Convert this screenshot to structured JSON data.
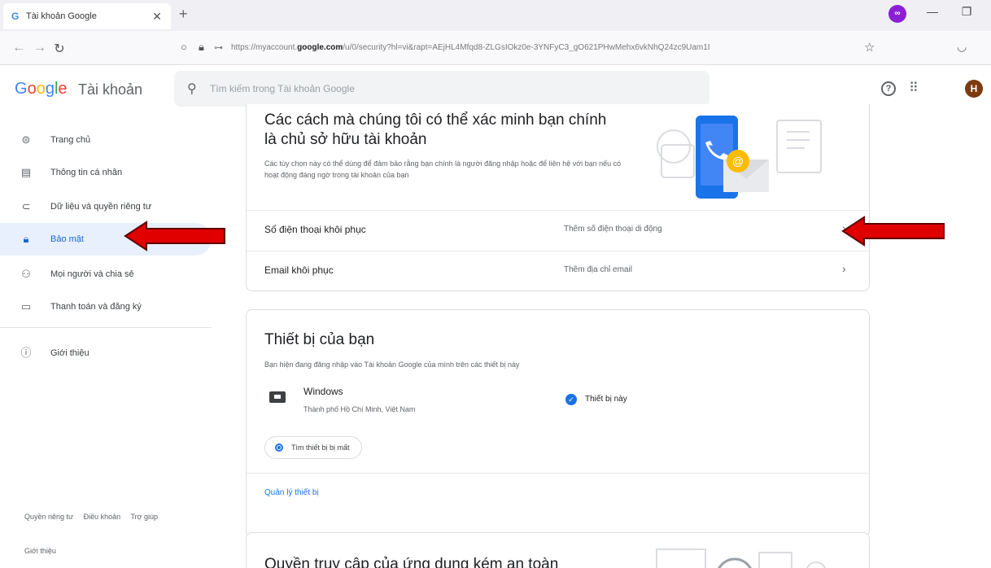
{
  "browser": {
    "tab_title": "Tài khoản Google",
    "tab_favicon": "G",
    "url_domain_prefix": "https://myaccount.",
    "url_domain": "google.com",
    "url_rest": "/u/0/security?hl=vi&rapt=AEjHL4Mfqd8-ZLGsIOkz0e-3YNFyC3_gO621PHwMehx6vkNhQ24zc9Uam1I",
    "ext_label": "∞"
  },
  "header": {
    "logo_letters": [
      "G",
      "o",
      "o",
      "g",
      "l",
      "e"
    ],
    "logo_suffix": "Tài khoản",
    "search_placeholder": "Tìm kiếm trong Tài khoản Google",
    "avatar_letter": "H",
    "help_glyph": "?"
  },
  "sidebar": {
    "items": [
      {
        "label": "Trang chủ",
        "icon": "home-icon"
      },
      {
        "label": "Thông tin cá nhân",
        "icon": "id-card-icon"
      },
      {
        "label": "Dữ liệu và quyền riêng tư",
        "icon": "toggle-icon"
      },
      {
        "label": "Bảo mật",
        "icon": "lock-icon",
        "active": true
      },
      {
        "label": "Mọi người và chia sẻ",
        "icon": "people-icon"
      },
      {
        "label": "Thanh toán và đăng ký",
        "icon": "card-icon"
      },
      {
        "label": "Giới thiệu",
        "icon": "info-icon"
      }
    ],
    "footer_links": [
      "Quyền riêng tư",
      "Điều khoản",
      "Trợ giúp"
    ],
    "footer_about": "Giới thiệu"
  },
  "verify_card": {
    "title": "Các cách mà chúng tôi có thể xác minh bạn chính là chủ sở hữu tài khoản",
    "description": "Các tùy chọn này có thể dùng để đảm bảo rằng bạn chính là người đăng nhập hoặc để liên hệ với bạn nếu có hoạt động đáng ngờ trong tài khoản của bạn",
    "rows": [
      {
        "label": "Số điện thoại khôi phục",
        "value": "Thêm số điện thoại di động"
      },
      {
        "label": "Email khôi phục",
        "value": "Thêm địa chỉ email"
      }
    ]
  },
  "devices_card": {
    "title": "Thiết bị của bạn",
    "subtitle": "Bạn hiện đang đăng nhập vào Tài khoản Google của mình trên các thiết bị này",
    "device_name": "Windows",
    "device_location": "Thành phố Hồ Chí Minh, Việt Nam",
    "this_device_label": "Thiết bị này",
    "find_button": "Tìm thiết bị bị mất",
    "manage_link": "Quản lý thiết bị"
  },
  "less_secure_card": {
    "title": "Quyền truy cập của ứng dụng kém an toàn"
  },
  "colors": {
    "accent_blue": "#1a73e8",
    "active_bg": "#e8f0fe",
    "annotation_red": "#e00000"
  }
}
